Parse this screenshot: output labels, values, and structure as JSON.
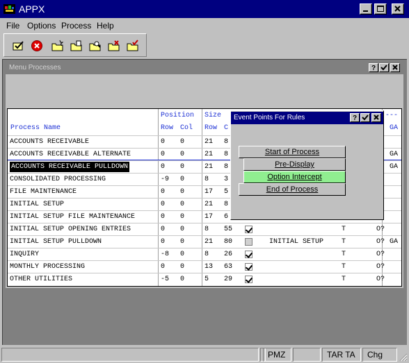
{
  "window": {
    "title": "APPX"
  },
  "menubar": {
    "items": [
      "File",
      "Options",
      "Process",
      "Help"
    ]
  },
  "toolbar": {
    "icons": [
      "checkmark-doc-icon",
      "cancel-icon",
      "folder-new-icon",
      "folder-open-icon",
      "folder-search-icon",
      "folder-delete-icon",
      "folder-check-icon"
    ]
  },
  "subwindow": {
    "title": "Menu Processes",
    "buttons": [
      "?",
      "✔",
      "✕"
    ]
  },
  "grid": {
    "headers": {
      "process_name": "Process Name",
      "position": "Position",
      "row": "Row",
      "col": "Col",
      "size": "Size",
      "size_row": "Row",
      "size_col": "C",
      "trailing": "---",
      "ga": "GA"
    },
    "rows": [
      {
        "name": "ACCOUNTS RECEIVABLE",
        "row": "0",
        "col": "0",
        "size_row": "21",
        "size_col": "8",
        "check": "",
        "menu": "",
        "t": "",
        "o": "",
        "ga": ""
      },
      {
        "name": "ACCOUNTS RECEIVABLE ALTERNATE",
        "row": "0",
        "col": "0",
        "size_row": "21",
        "size_col": "8",
        "check": "",
        "menu": "",
        "t": "",
        "o": "",
        "ga": "GA"
      },
      {
        "name": "ACCOUNTS RECEIVABLE PULLDOWN",
        "row": "0",
        "col": "0",
        "size_row": "21",
        "size_col": "8",
        "check": "",
        "menu": "",
        "t": "",
        "o": "",
        "ga": "GA"
      },
      {
        "name": "CONSOLIDATED PROCESSING",
        "row": "-9",
        "col": "0",
        "size_row": "8",
        "size_col": "3",
        "check": "",
        "menu": "",
        "t": "",
        "o": "",
        "ga": ""
      },
      {
        "name": "FILE MAINTENANCE",
        "row": "0",
        "col": "0",
        "size_row": "17",
        "size_col": "5",
        "check": "",
        "menu": "",
        "t": "",
        "o": "",
        "ga": ""
      },
      {
        "name": "INITIAL SETUP",
        "row": "0",
        "col": "0",
        "size_row": "21",
        "size_col": "8",
        "check": "",
        "menu": "",
        "t": "",
        "o": "",
        "ga": ""
      },
      {
        "name": "INITIAL SETUP FILE MAINTENANCE",
        "row": "0",
        "col": "0",
        "size_row": "17",
        "size_col": "6",
        "check": "",
        "menu": "",
        "t": "",
        "o": "",
        "ga": ""
      },
      {
        "name": "INITIAL SETUP OPENING ENTRIES",
        "row": "0",
        "col": "0",
        "size_row": "8",
        "size_col": "55",
        "check": "checked",
        "menu": "",
        "t": "T",
        "o": "O?",
        "ga": ""
      },
      {
        "name": "INITIAL SETUP PULLDOWN",
        "row": "0",
        "col": "0",
        "size_row": "21",
        "size_col": "80",
        "check": "gray",
        "menu": "INITIAL SETUP",
        "t": "T",
        "o": "O?",
        "ga": "GA"
      },
      {
        "name": "INQUIRY",
        "row": "-8",
        "col": "0",
        "size_row": "8",
        "size_col": "26",
        "check": "checked",
        "menu": "",
        "t": "T",
        "o": "O?",
        "ga": ""
      },
      {
        "name": "MONTHLY PROCESSING",
        "row": "0",
        "col": "0",
        "size_row": "13",
        "size_col": "63",
        "check": "checked",
        "menu": "",
        "t": "T",
        "o": "O?",
        "ga": ""
      },
      {
        "name": "OTHER UTILITIES",
        "row": "-5",
        "col": "0",
        "size_row": "5",
        "size_col": "29",
        "check": "checked",
        "menu": "",
        "t": "T",
        "o": "O?",
        "ga": ""
      }
    ]
  },
  "dialog": {
    "title": "Event Points For Rules",
    "buttons": [
      "Start of Process",
      "Pre-Display",
      "Option Intercept",
      "End of Process"
    ],
    "tbuttons": [
      "?",
      "✔",
      "✕"
    ]
  },
  "statusbar": {
    "panels": [
      "",
      "",
      "PMZ",
      "",
      "TAR TA",
      "Chg"
    ]
  }
}
